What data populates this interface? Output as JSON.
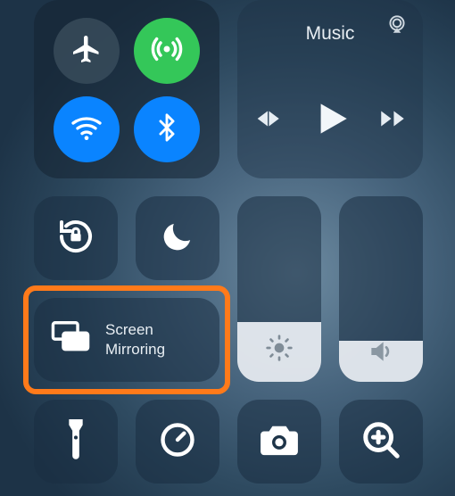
{
  "connectivity": {
    "airplane_on": false,
    "cellular_on": true,
    "wifi_on": true,
    "bluetooth_on": true
  },
  "media": {
    "title": "Music",
    "playing": false
  },
  "rotation_lock_on": false,
  "dnd_on": false,
  "screen_mirroring": {
    "label_line1": "Screen",
    "label_line2": "Mirroring"
  },
  "brightness_pct": 32,
  "volume_pct": 22,
  "highlight_color": "#ff7a1a"
}
